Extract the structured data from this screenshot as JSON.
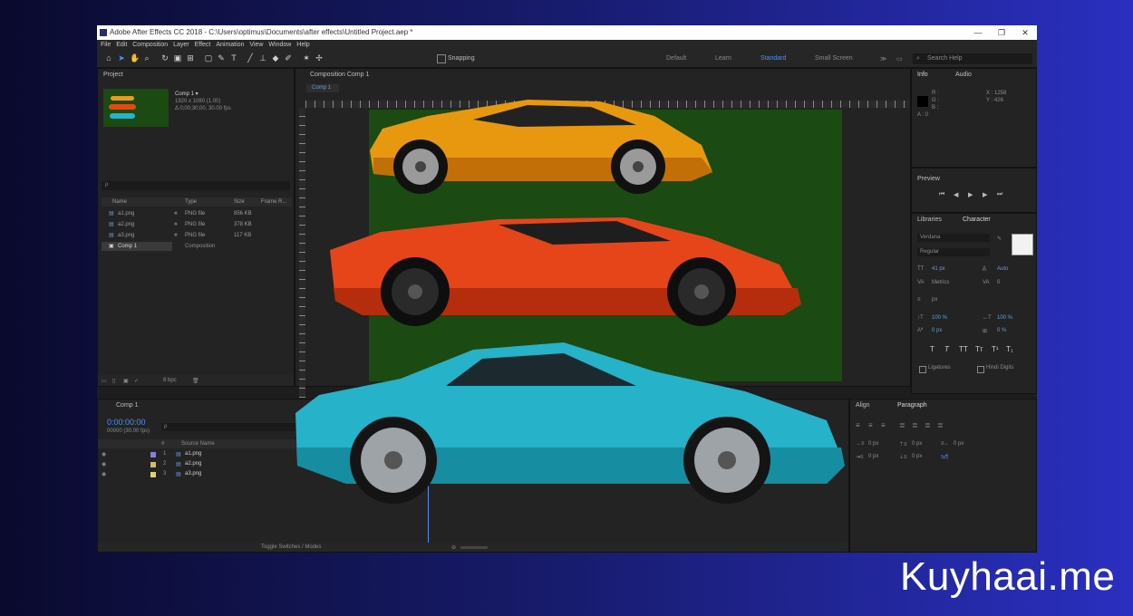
{
  "window": {
    "title": "Adobe After Effects CC 2018 - C:\\Users\\optimus\\Documents\\after effects\\Untitled Project.aep *",
    "minimize": "—",
    "maximize": "❐",
    "close": "✕"
  },
  "menu": [
    "File",
    "Edit",
    "Composition",
    "Layer",
    "Effect",
    "Animation",
    "View",
    "Window",
    "Help"
  ],
  "toolbar": {
    "snapping": "Snapping",
    "workspaces": [
      "Default",
      "Learn",
      "Standard",
      "Small Screen"
    ],
    "search_placeholder": "Search Help"
  },
  "project": {
    "title": "Project",
    "comp_name": "Comp 1 ▾",
    "comp_info_1": "1920 x 1080 (1.00)",
    "comp_info_2": "Δ 0;00;30;00, 30.00 fps",
    "search_placeholder": "ρ",
    "columns": [
      "Name",
      "Type",
      "Size",
      "Frame R..."
    ],
    "items": [
      {
        "name": "a1.png",
        "type": "PNG file",
        "size": "856 KB"
      },
      {
        "name": "a2.png",
        "type": "PNG file",
        "size": "378 KB"
      },
      {
        "name": "a3.png",
        "type": "PNG file",
        "size": "117 KB"
      },
      {
        "name": "Comp 1",
        "type": "Composition",
        "size": ""
      }
    ],
    "bpc": "8 bpc"
  },
  "composition": {
    "tab_title": "Composition Comp 1",
    "subtab": "Comp 1",
    "ruler_ticks": [
      "200",
      "300",
      "400",
      "500",
      "600",
      "700",
      "800",
      "900",
      "1000",
      "1100",
      "1200",
      "1300",
      "1400",
      "1500",
      "1600",
      "1700",
      "1800",
      "1900"
    ]
  },
  "info": {
    "tabs": [
      "Info",
      "Audio"
    ],
    "r": "R :",
    "g": "G :",
    "b": "B :",
    "a": "A : 0",
    "x": "X : 1258",
    "y": "Y : 426"
  },
  "preview": {
    "title": "Preview"
  },
  "character": {
    "tabs": [
      "Libraries",
      "Character"
    ],
    "font": "Verdana",
    "style": "Regular",
    "size": "41 px",
    "leading": "Auto",
    "kerning": "Metrics",
    "tracking": "0",
    "stroke": "px",
    "vscale": "100 %",
    "hscale": "100 %",
    "baseline": "0 px",
    "tsume": "0 %",
    "styles": [
      "T",
      "T",
      "TT",
      "Tт",
      "T¹",
      "T₁"
    ],
    "ligatures": "Ligatures",
    "hindi": "Hindi Digits"
  },
  "timeline": {
    "comp_tab": "Comp 1",
    "timecode": "0:00:00:00",
    "fps": "00000 (30.00 fps)",
    "columns": [
      "#",
      "Source Name"
    ],
    "layers": [
      {
        "num": "1",
        "name": "a1.png",
        "color": "#8a7fd6"
      },
      {
        "num": "2",
        "name": "a2.png",
        "color": "#d6b96a"
      },
      {
        "num": "3",
        "name": "a3.png",
        "color": "#e0d07a"
      }
    ],
    "bottom": "Toggle Switches / Modes"
  },
  "paragraph": {
    "tabs": [
      "Align",
      "Paragraph"
    ],
    "values": [
      "0 px",
      "0 px",
      "0 px",
      "0 px",
      "0 px"
    ]
  },
  "watermark": "Kuyhaai.me"
}
